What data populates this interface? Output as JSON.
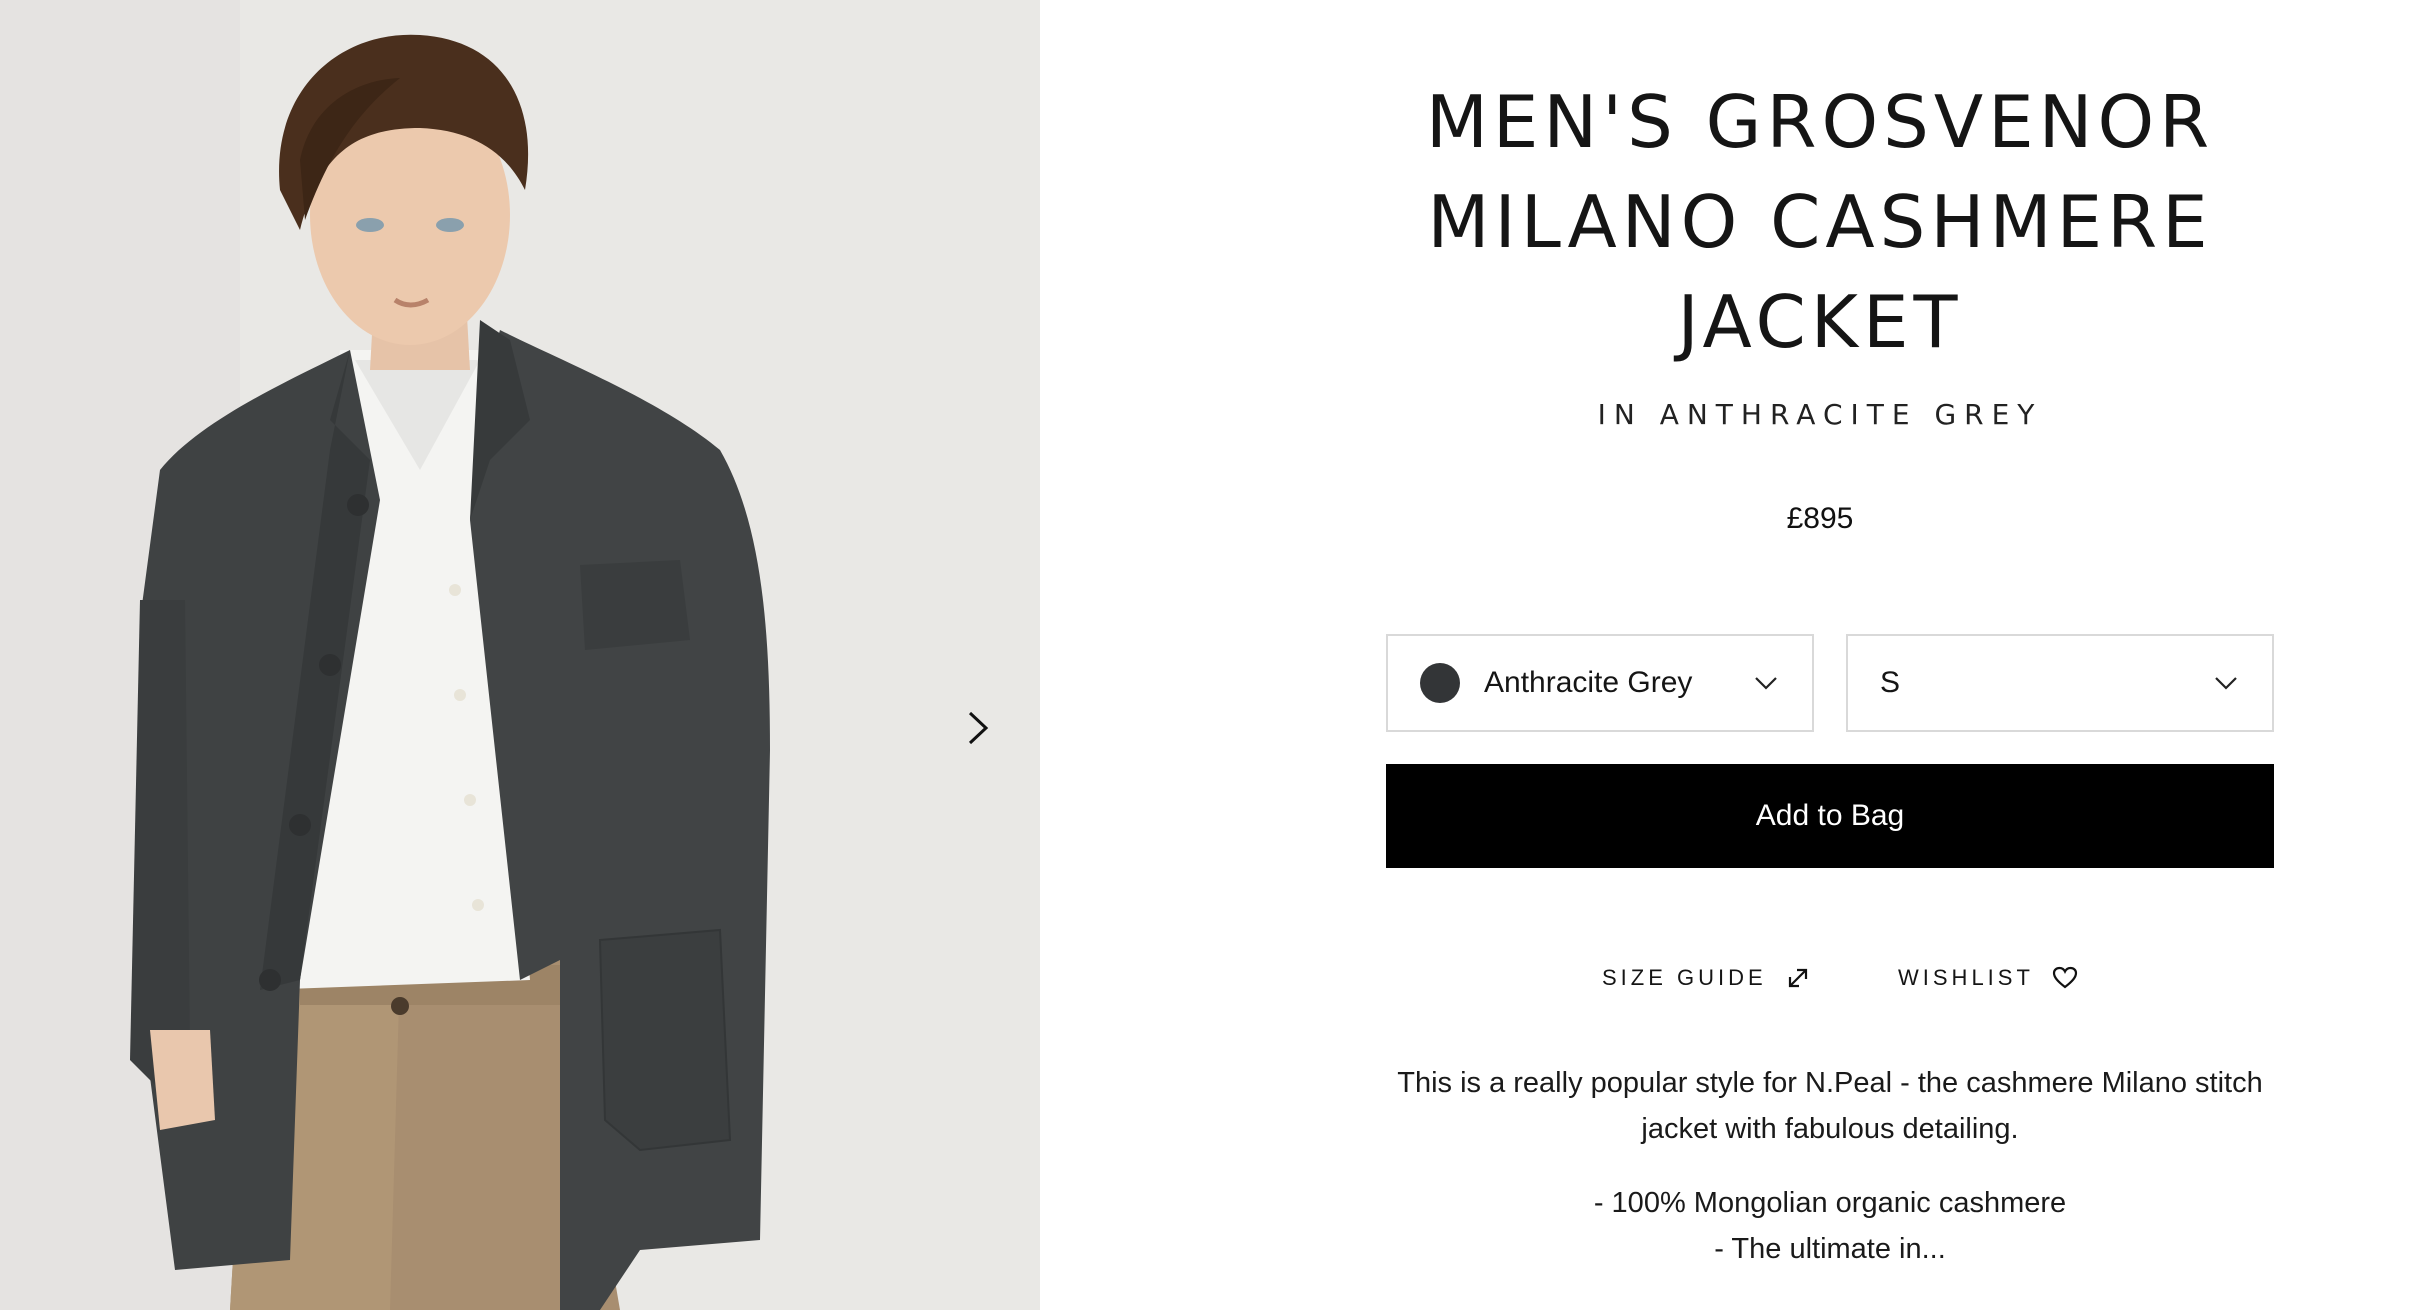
{
  "product": {
    "title": "MEN'S GROSVENOR MILANO CASHMERE JACKET",
    "subtitle": "IN ANTHRACITE GREY",
    "price": "£895"
  },
  "options": {
    "color": {
      "selected": "Anthracite Grey",
      "swatch_color": "#333537"
    },
    "size": {
      "selected": "S"
    }
  },
  "actions": {
    "add_to_bag": "Add to Bag",
    "size_guide": "SIZE GUIDE",
    "wishlist": "WISHLIST"
  },
  "description": {
    "intro": "This is a really popular style for N.Peal - the cashmere Milano stitch jacket with fabulous detailing.",
    "bullets": [
      "- 100% Mongolian organic cashmere",
      "- The ultimate in..."
    ]
  },
  "icons": {
    "carousel_next": "chevron-right-icon",
    "select_chevron": "chevron-down-icon",
    "size_guide": "external-link-icon",
    "wishlist": "heart-icon"
  },
  "colors": {
    "primary_button": "#000000",
    "background": "#ffffff",
    "image_background": "#e9e8e5"
  }
}
